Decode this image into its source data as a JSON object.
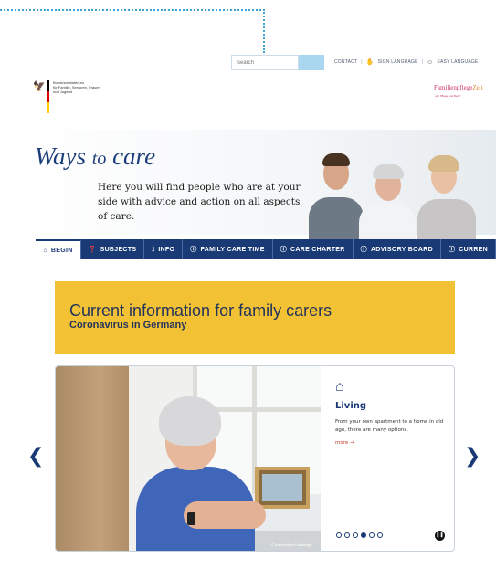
{
  "search": {
    "placeholder": "search"
  },
  "top_links": {
    "contact": "CONTACT",
    "sign_language": "SIGN LANGUAGE",
    "easy_language": "EASY LANGUAGE",
    "separator": "|"
  },
  "ministry": {
    "line1": "Bundesministerium",
    "line2": "für Familie, Senioren, Frauen",
    "line3": "und Jugend"
  },
  "partner_logo": {
    "name_main": "Familienpflege",
    "name_accent": "Zeit",
    "tagline": "und Pflege und Beruf"
  },
  "hero": {
    "title_ways": "Ways",
    "title_to": "to",
    "title_care": "care",
    "text": "Here you will find people who are at your side with advice and action on all aspects of care."
  },
  "nav": {
    "items": [
      {
        "icon": "home-icon",
        "glyph": "⌂",
        "label": "BEGIN"
      },
      {
        "icon": "question-icon",
        "glyph": "❓",
        "label": "SUBJECTS"
      },
      {
        "icon": "info-icon",
        "glyph": "ℹ",
        "label": "INFO"
      },
      {
        "icon": "circle-info-icon",
        "glyph": "ⓘ",
        "label": "FAMILY CARE TIME"
      },
      {
        "icon": "circle-info-icon",
        "glyph": "ⓘ",
        "label": "CARE CHARTER"
      },
      {
        "icon": "circle-info-icon",
        "glyph": "ⓘ",
        "label": "ADVISORY BOARD"
      },
      {
        "icon": "circle-info-icon",
        "glyph": "ⓘ",
        "label": "CURREN"
      }
    ]
  },
  "banner": {
    "title": "Current information for family carers",
    "subtitle": "Coronavirus in Germany"
  },
  "slider": {
    "title": "Living",
    "text": "From your own apartment to a home in old age, there are many options.",
    "more": "more →",
    "credit": "© plainpicture/Caiaimage",
    "active_slide": 4,
    "slide_count": 6
  },
  "colors": {
    "nav_bg": "#1a3a76",
    "banner_bg": "#f3c234",
    "accent_link": "#c0392b"
  }
}
